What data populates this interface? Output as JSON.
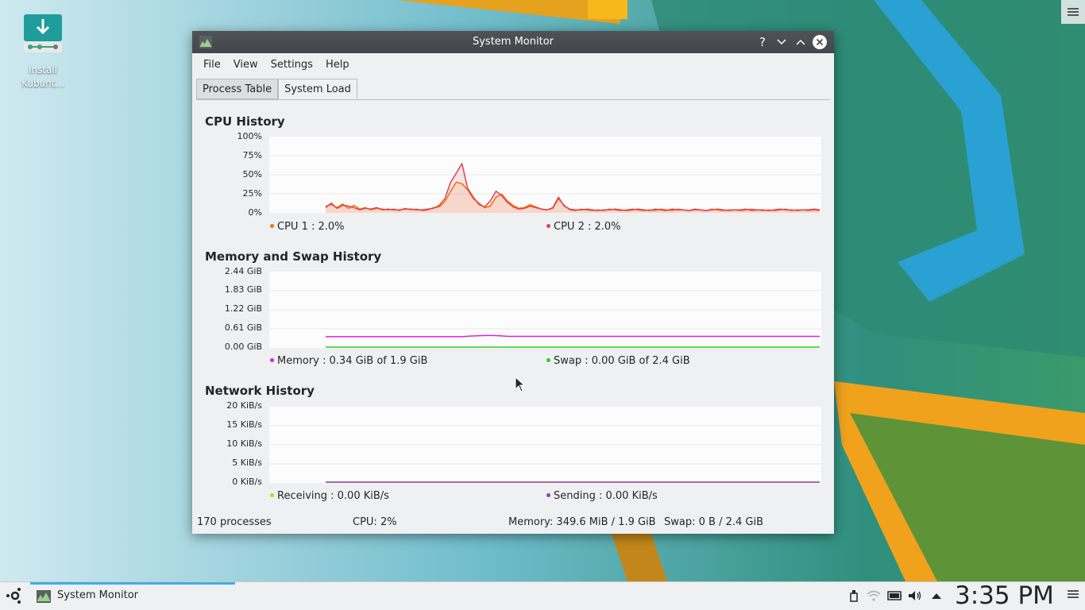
{
  "desktop": {
    "icon_label_line1": "Install",
    "icon_label_line2": "Kubunt..."
  },
  "window": {
    "title": "System Monitor",
    "buttons": {
      "help": "?",
      "minimize": "minimize",
      "maximize": "maximize",
      "close": "close"
    }
  },
  "menu": [
    "File",
    "View",
    "Settings",
    "Help"
  ],
  "tabs": [
    {
      "label": "Process Table",
      "active": false
    },
    {
      "label": "System Load",
      "active": true
    }
  ],
  "cpu": {
    "title": "CPU History",
    "yticks": [
      "100%",
      "75%",
      "50%",
      "25%",
      "0%"
    ],
    "legend": [
      {
        "label": "CPU 1 : 2.0%",
        "color": "#f67400"
      },
      {
        "label": "CPU 2 : 2.0%",
        "color": "#da4453"
      }
    ]
  },
  "memory": {
    "title": "Memory and Swap History",
    "yticks": [
      "2.44 GiB",
      "1.83 GiB",
      "1.22 GiB",
      "0.61 GiB",
      "0.00 GiB"
    ],
    "legend": [
      {
        "label": "Memory : 0.34 GiB of 1.9 GiB",
        "color": "#e020e0"
      },
      {
        "label": "Swap : 0.00 GiB of 2.4 GiB",
        "color": "#27cf27"
      }
    ]
  },
  "network": {
    "title": "Network History",
    "yticks": [
      "20 KiB/s",
      "15 KiB/s",
      "10 KiB/s",
      "5 KiB/s",
      "0 KiB/s"
    ],
    "legend": [
      {
        "label": "Receiving : 0.00 KiB/s",
        "color": "#c9ce3b"
      },
      {
        "label": "Sending : 0.00 KiB/s",
        "color": "#8e44ad"
      }
    ]
  },
  "status": {
    "processes": "170 processes",
    "cpu": "CPU: 2%",
    "memory": "Memory: 349.6 MiB / 1.9 GiB",
    "swap": "Swap: 0 B / 2.4 GiB"
  },
  "taskbar": {
    "task_label": "System Monitor",
    "clock": "3:35 PM",
    "tray_icons": [
      "usb-icon",
      "wifi-icon",
      "battery-icon",
      "volume-icon",
      "expand-up-icon"
    ]
  },
  "chart_data": [
    {
      "type": "area",
      "title": "CPU History",
      "ylabel": "",
      "ylim": [
        0,
        100
      ],
      "series": [
        {
          "name": "CPU 1",
          "color": "#f67400",
          "values": [
            8,
            10,
            6,
            11,
            5,
            9,
            4,
            6,
            3,
            5,
            4,
            3,
            4,
            2,
            5,
            3,
            4,
            2,
            3,
            6,
            7,
            14,
            28,
            40,
            38,
            30,
            18,
            12,
            6,
            8,
            20,
            24,
            15,
            9,
            5,
            6,
            10,
            7,
            4,
            3,
            5,
            18,
            9,
            3,
            2,
            4,
            3,
            2,
            3,
            2,
            4,
            3,
            2,
            3,
            4,
            3,
            2,
            3,
            2,
            4,
            3,
            2,
            4,
            3,
            2,
            3,
            3,
            2,
            4,
            3,
            2,
            3,
            3,
            2,
            3,
            4,
            3,
            2,
            3,
            2,
            3,
            4,
            2,
            3,
            3,
            2,
            3,
            2
          ]
        },
        {
          "name": "CPU 2",
          "color": "#da4453",
          "values": [
            6,
            12,
            5,
            9,
            8,
            6,
            3,
            5,
            4,
            6,
            3,
            4,
            3,
            3,
            4,
            4,
            3,
            3,
            4,
            5,
            9,
            18,
            40,
            52,
            65,
            32,
            20,
            10,
            7,
            15,
            28,
            22,
            13,
            7,
            4,
            5,
            8,
            6,
            4,
            3,
            6,
            20,
            8,
            4,
            3,
            3,
            4,
            3,
            2,
            3,
            3,
            4,
            3,
            2,
            3,
            4,
            3,
            2,
            4,
            3,
            2,
            4,
            3,
            3,
            2,
            4,
            3,
            2,
            3,
            4,
            3,
            2,
            3,
            3,
            4,
            2,
            3,
            3,
            2,
            3,
            4,
            3,
            3,
            2,
            3,
            3,
            4,
            3
          ]
        }
      ]
    },
    {
      "type": "line",
      "title": "Memory and Swap History",
      "ylim": [
        0,
        2.44
      ],
      "series": [
        {
          "name": "Memory",
          "color": "#e020e0",
          "values": [
            0.34,
            0.34,
            0.34,
            0.34,
            0.34,
            0.34,
            0.34,
            0.34,
            0.34,
            0.34,
            0.34,
            0.34,
            0.34,
            0.34,
            0.34,
            0.34,
            0.34,
            0.34,
            0.34,
            0.36,
            0.37,
            0.38,
            0.38,
            0.37,
            0.35,
            0.35,
            0.35,
            0.35,
            0.35,
            0.35,
            0.35,
            0.35,
            0.35,
            0.35,
            0.35,
            0.35,
            0.35,
            0.35,
            0.35,
            0.35,
            0.35,
            0.35,
            0.35,
            0.35,
            0.35,
            0.35,
            0.35,
            0.35,
            0.35,
            0.35,
            0.35,
            0.35,
            0.35,
            0.35,
            0.35,
            0.35,
            0.35,
            0.35,
            0.35,
            0.35,
            0.35,
            0.35,
            0.35,
            0.35,
            0.35,
            0.35
          ]
        },
        {
          "name": "Swap",
          "color": "#27cf27",
          "values": [
            0,
            0,
            0,
            0,
            0,
            0,
            0,
            0,
            0,
            0,
            0,
            0,
            0,
            0,
            0,
            0,
            0,
            0,
            0,
            0,
            0,
            0,
            0,
            0,
            0,
            0,
            0,
            0,
            0,
            0,
            0,
            0,
            0,
            0,
            0,
            0,
            0,
            0,
            0,
            0,
            0,
            0,
            0,
            0,
            0,
            0,
            0,
            0,
            0,
            0,
            0,
            0,
            0,
            0,
            0,
            0,
            0,
            0,
            0,
            0,
            0,
            0,
            0,
            0,
            0,
            0
          ]
        }
      ]
    },
    {
      "type": "line",
      "title": "Network History",
      "ylim": [
        0,
        20
      ],
      "series": [
        {
          "name": "Receiving",
          "color": "#c9ce3b",
          "values": [
            0,
            0,
            0,
            0,
            0,
            0,
            0,
            0,
            0,
            0,
            0,
            0,
            0,
            0,
            0,
            0,
            0,
            0,
            0,
            0,
            0,
            0,
            0,
            0,
            0,
            0,
            0,
            0,
            0,
            0,
            0
          ]
        },
        {
          "name": "Sending",
          "color": "#8e44ad",
          "values": [
            0,
            0,
            0,
            0,
            0,
            0,
            0,
            0,
            0,
            0,
            0,
            0,
            0,
            0,
            0,
            0,
            0,
            0,
            0,
            0,
            0,
            0,
            0,
            0,
            0,
            0,
            0,
            0,
            0,
            0,
            0
          ]
        }
      ]
    }
  ]
}
